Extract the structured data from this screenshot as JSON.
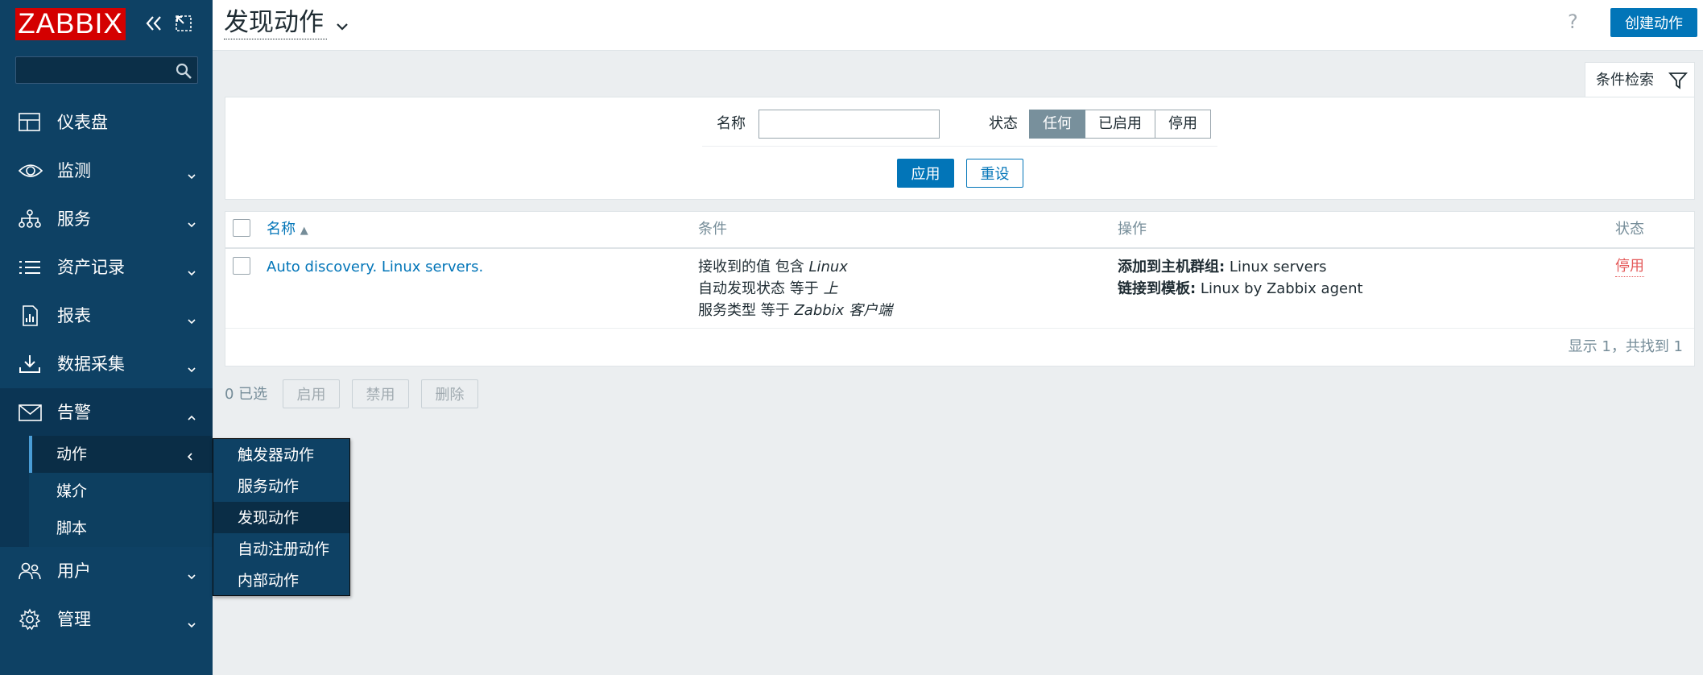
{
  "sidebar": {
    "logo": "ZABBIX",
    "search": {
      "value": "",
      "placeholder": ""
    },
    "items": [
      {
        "label": "仪表盘",
        "icon": "dashboard-icon"
      },
      {
        "label": "监测",
        "icon": "eye-icon"
      },
      {
        "label": "服务",
        "icon": "services-icon"
      },
      {
        "label": "资产记录",
        "icon": "list-icon"
      },
      {
        "label": "报表",
        "icon": "report-icon"
      },
      {
        "label": "数据采集",
        "icon": "download-icon"
      },
      {
        "label": "告警",
        "icon": "envelope-icon"
      },
      {
        "label": "用户",
        "icon": "users-icon"
      },
      {
        "label": "管理",
        "icon": "gear-icon"
      }
    ],
    "alerts_sub": [
      {
        "label": "动作"
      },
      {
        "label": "媒介"
      },
      {
        "label": "脚本"
      }
    ],
    "actions_flyout": [
      {
        "label": "触发器动作"
      },
      {
        "label": "服务动作"
      },
      {
        "label": "发现动作"
      },
      {
        "label": "自动注册动作"
      },
      {
        "label": "内部动作"
      }
    ]
  },
  "header": {
    "title": "发现动作",
    "help": "?",
    "create_button": "创建动作"
  },
  "filter": {
    "tab_label": "条件检索",
    "name_label": "名称",
    "name_value": "",
    "status_label": "状态",
    "status_options": [
      "任何",
      "已启用",
      "停用"
    ],
    "status_selected": "任何",
    "apply_button": "应用",
    "reset_button": "重设"
  },
  "table": {
    "columns": [
      "名称",
      "条件",
      "操作",
      "状态"
    ],
    "sort_indicator": "▲",
    "rows": [
      {
        "name": "Auto discovery. Linux servers.",
        "conditions": [
          {
            "text": "接收到的值 包含 ",
            "value": "Linux"
          },
          {
            "text": "自动发现状态 等于 ",
            "value": "上"
          },
          {
            "text": "服务类型 等于 ",
            "value": "Zabbix 客户端"
          }
        ],
        "operations": [
          {
            "key": "添加到主机群组:",
            "value": " Linux servers"
          },
          {
            "key": "链接到模板:",
            "value": " Linux by Zabbix agent"
          }
        ],
        "status": "停用"
      }
    ],
    "paging": "显示 1，共找到 1"
  },
  "footer": {
    "selected": "0 已选",
    "buttons": [
      "启用",
      "禁用",
      "删除"
    ]
  },
  "colors": {
    "sidebar": "#0e4164",
    "accent": "#0275b8",
    "disabled_status": "#e45959",
    "logo": "#d40000"
  }
}
